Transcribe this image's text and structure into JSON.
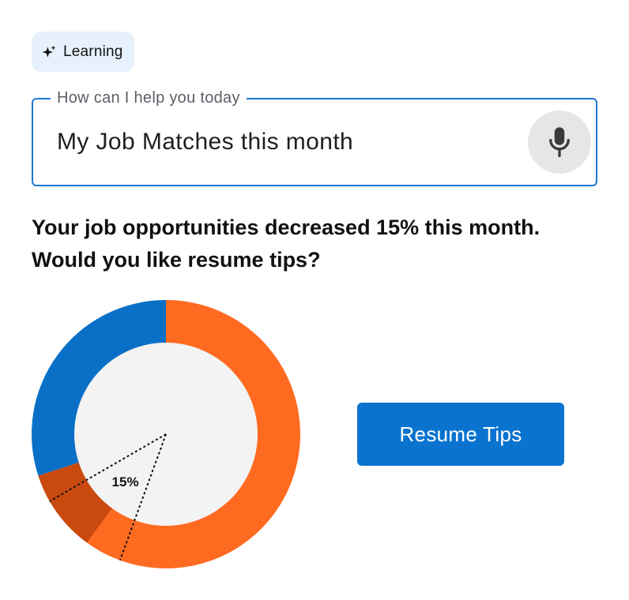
{
  "chip": {
    "label": "Learning",
    "icon": "sparkle-icon"
  },
  "prompt_field": {
    "legend": "How can I help you today",
    "value": "My Job Matches this month",
    "mic_icon": "microphone-icon"
  },
  "message": {
    "line1": "Your job opportunities decreased 15% this month.",
    "line2": "Would you like resume tips?"
  },
  "resume_button": {
    "label": "Resume Tips"
  },
  "colors": {
    "accent_blue": "#0a73cf",
    "chip_bg": "#e6f1fb",
    "field_border": "#1c7ad1",
    "segment_orange": "#ff6a21",
    "segment_dark_orange": "#c9490f",
    "segment_blue": "#0a70c7",
    "donut_center": "#f3f3f3",
    "mic_bg": "#e6e6e6"
  },
  "chart_data": {
    "type": "pie",
    "style": "donut",
    "slices": [
      {
        "value": 60,
        "color": "#ff6a21"
      },
      {
        "value": 10,
        "color": "#c9490f"
      },
      {
        "value": 30,
        "color": "#0a70c7"
      }
    ],
    "annotation": "15%",
    "annotation_wedge_degrees": [
      200,
      240
    ]
  }
}
